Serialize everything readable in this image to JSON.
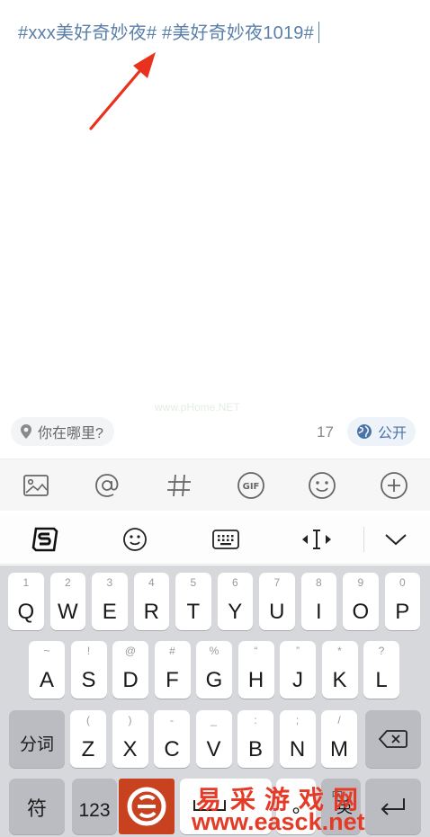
{
  "compose": {
    "text": "#xxx美好奇妙夜# #美好奇妙夜1019#",
    "faint_watermark": "www.pHome.NET"
  },
  "location": {
    "label": "你在哪里?"
  },
  "char_count": "17",
  "visibility": {
    "label": "公开"
  },
  "attach_toolbar": {
    "icons": [
      "image-icon",
      "at-mention-icon",
      "hashtag-icon",
      "gif-icon",
      "emoji-icon",
      "add-icon"
    ]
  },
  "keyboard_toolbar": {
    "icons": [
      "sogou-logo-icon",
      "emoji-icon",
      "keyboard-icon",
      "cursor-move-icon",
      "collapse-chevron-icon"
    ]
  },
  "keyboard": {
    "row1": [
      {
        "hint": "1",
        "key": "Q"
      },
      {
        "hint": "2",
        "key": "W"
      },
      {
        "hint": "3",
        "key": "E"
      },
      {
        "hint": "4",
        "key": "R"
      },
      {
        "hint": "5",
        "key": "T"
      },
      {
        "hint": "6",
        "key": "Y"
      },
      {
        "hint": "7",
        "key": "U"
      },
      {
        "hint": "8",
        "key": "I"
      },
      {
        "hint": "9",
        "key": "O"
      },
      {
        "hint": "0",
        "key": "P"
      }
    ],
    "row2": [
      {
        "hint": "~",
        "key": "A"
      },
      {
        "hint": "!",
        "key": "S"
      },
      {
        "hint": "@",
        "key": "D"
      },
      {
        "hint": "#",
        "key": "F"
      },
      {
        "hint": "%",
        "key": "G"
      },
      {
        "hint": "“",
        "key": "H"
      },
      {
        "hint": "”",
        "key": "J"
      },
      {
        "hint": "*",
        "key": "K"
      },
      {
        "hint": "?",
        "key": "L"
      }
    ],
    "row3": [
      {
        "hint": "(",
        "key": "Z"
      },
      {
        "hint": ")",
        "key": "X"
      },
      {
        "hint": "-",
        "key": "C"
      },
      {
        "hint": "_",
        "key": "V"
      },
      {
        "hint": ":",
        "key": "B"
      },
      {
        "hint": ";",
        "key": "N"
      },
      {
        "hint": "/",
        "key": "M"
      }
    ],
    "segment_label": "分词",
    "symbol_label": "符",
    "number_label": "123",
    "lang_label": "英",
    "lang_sub": "中"
  },
  "site_watermark": {
    "name": "易采游戏网",
    "url": "www.easck.net"
  },
  "colors": {
    "topic_blue": "#5a7fa8",
    "arrow_red": "#e8321e",
    "watermark_red": "#e43a26",
    "keyboard_bg": "#d6d8dc"
  }
}
